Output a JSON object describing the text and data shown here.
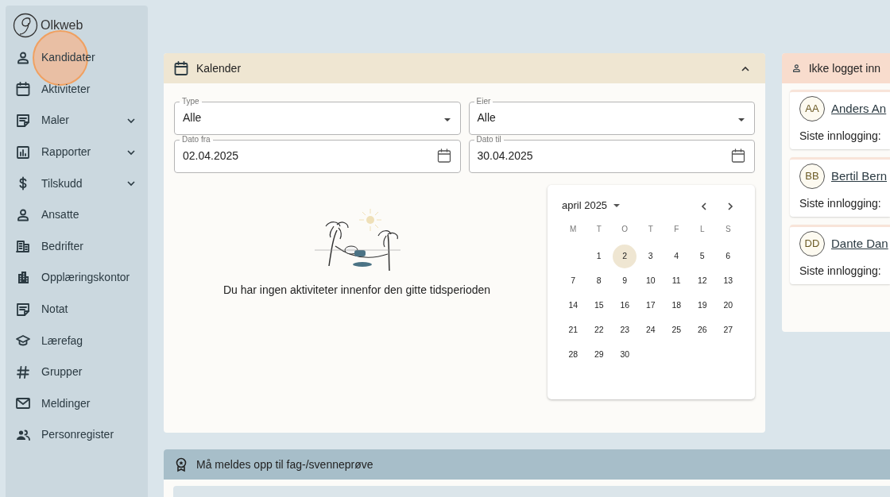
{
  "app": {
    "name": "Olkweb"
  },
  "sidebar": {
    "items": [
      {
        "kind": "person",
        "label": "Kandidater",
        "expandable": false,
        "clicked": true
      },
      {
        "kind": "calendar",
        "label": "Aktiviteter",
        "expandable": false,
        "clicked": false
      },
      {
        "kind": "note",
        "label": "Maler",
        "expandable": true,
        "clicked": false
      },
      {
        "kind": "chart",
        "label": "Rapporter",
        "expandable": true,
        "clicked": false
      },
      {
        "kind": "dollar",
        "label": "Tilskudd",
        "expandable": true,
        "clicked": false
      },
      {
        "kind": "person",
        "label": "Ansatte",
        "expandable": false,
        "clicked": false
      },
      {
        "kind": "building",
        "label": "Bedrifter",
        "expandable": false,
        "clicked": false
      },
      {
        "kind": "office",
        "label": "Opplæringskontor",
        "expandable": false,
        "clicked": false
      },
      {
        "kind": "note",
        "label": "Notat",
        "expandable": false,
        "clicked": false
      },
      {
        "kind": "cap",
        "label": "Lærefag",
        "expandable": false,
        "clicked": false
      },
      {
        "kind": "hash",
        "label": "Grupper",
        "expandable": false,
        "clicked": false
      },
      {
        "kind": "mail",
        "label": "Meldinger",
        "expandable": false,
        "clicked": false
      },
      {
        "kind": "people",
        "label": "Personregister",
        "expandable": false,
        "clicked": false
      }
    ]
  },
  "calendar_panel": {
    "title": "Kalender",
    "expanded": true,
    "fields": [
      {
        "kind": "select",
        "label": "Type",
        "value": "Alle"
      },
      {
        "kind": "select",
        "label": "Eier",
        "value": "Alle"
      },
      {
        "kind": "date",
        "label": "Dato fra",
        "value": "02.04.2025"
      },
      {
        "kind": "date",
        "label": "Dato til",
        "value": "30.04.2025"
      }
    ],
    "empty_message": "Du har ingen aktiviteter innenfor den gitte tidsperioden",
    "date_picker": {
      "month": "april 2025",
      "weekdays": [
        "M",
        "T",
        "O",
        "T",
        "F",
        "L",
        "S"
      ],
      "weeks": [
        [
          {
            "day": "1",
            "selected": false
          },
          {
            "day": "2",
            "selected": true
          },
          {
            "day": "3",
            "selected": false
          },
          {
            "day": "4",
            "selected": false
          },
          {
            "day": "5",
            "selected": false
          },
          {
            "day": "6",
            "selected": false
          }
        ],
        [
          {
            "day": "7",
            "selected": false
          },
          {
            "day": "8",
            "selected": false
          },
          {
            "day": "9",
            "selected": false
          },
          {
            "day": "10",
            "selected": false
          },
          {
            "day": "11",
            "selected": false
          },
          {
            "day": "12",
            "selected": false
          },
          {
            "day": "13",
            "selected": false
          }
        ],
        [
          {
            "day": "14",
            "selected": false
          },
          {
            "day": "15",
            "selected": false
          },
          {
            "day": "16",
            "selected": false
          },
          {
            "day": "17",
            "selected": false
          },
          {
            "day": "18",
            "selected": false
          },
          {
            "day": "19",
            "selected": false
          },
          {
            "day": "20",
            "selected": false
          }
        ],
        [
          {
            "day": "21",
            "selected": false
          },
          {
            "day": "22",
            "selected": false
          },
          {
            "day": "23",
            "selected": false
          },
          {
            "day": "24",
            "selected": false
          },
          {
            "day": "25",
            "selected": false
          },
          {
            "day": "26",
            "selected": false
          },
          {
            "day": "27",
            "selected": false
          }
        ],
        [
          {
            "day": "28",
            "selected": false
          },
          {
            "day": "29",
            "selected": false
          },
          {
            "day": "30",
            "selected": false
          }
        ]
      ]
    }
  },
  "login_panel": {
    "title": "Ikke logget inn",
    "users": [
      {
        "initials": "AA",
        "name": "Anders An",
        "last_login_label": "Siste innlogging:"
      },
      {
        "initials": "BB",
        "name": "Bertil Bern",
        "last_login_label": "Siste innlogging:"
      },
      {
        "initials": "DD",
        "name": "Dante Dan",
        "last_login_label": "Siste innlogging:"
      }
    ]
  },
  "exam_panel": {
    "title": "Må meldes opp til fag-/svenneprøve"
  }
}
